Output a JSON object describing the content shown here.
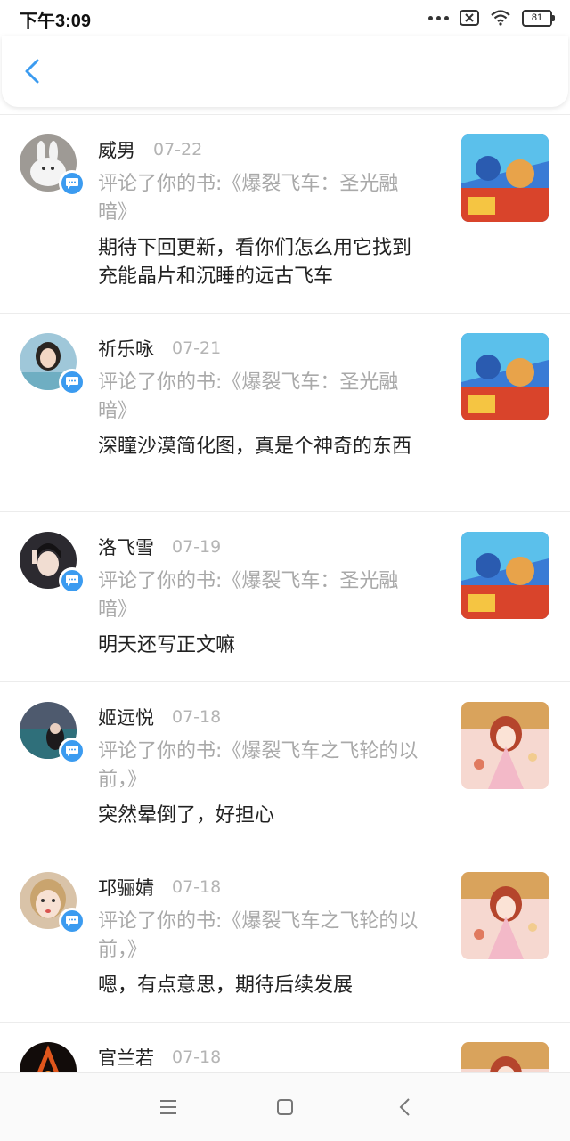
{
  "status_bar": {
    "time": "下午3:09",
    "battery": "81"
  },
  "colors": {
    "accent": "#3b9bf0",
    "meta_text": "#a9a9a9",
    "divider": "#ececec"
  },
  "icons": {
    "back": "chevron-left-icon",
    "badge": "comment-bubble-icon",
    "nav": [
      "menu-icon",
      "home-square-icon",
      "back-triangle-icon"
    ]
  },
  "notifications": [
    {
      "name": "威男",
      "date": "07-22",
      "summary": "评论了你的书:《爆裂飞车：圣光融暗》",
      "comment": "期待下回更新，看你们怎么用它找到充能晶片和沉睡的远古飞车"
    },
    {
      "name": "祈乐咏",
      "date": "07-21",
      "summary": "评论了你的书:《爆裂飞车：圣光融暗》",
      "comment": "深瞳沙漠简化图，真是个神奇的东西"
    },
    {
      "name": "洛飞雪",
      "date": "07-19",
      "summary": "评论了你的书:《爆裂飞车：圣光融暗》",
      "comment": "明天还写正文嘛"
    },
    {
      "name": "姬远悦",
      "date": "07-18",
      "summary": "评论了你的书:《爆裂飞车之飞轮的以前，》",
      "comment": "突然晕倒了，好担心"
    },
    {
      "name": "邛骊婧",
      "date": "07-18",
      "summary": "评论了你的书:《爆裂飞车之飞轮的以前，》",
      "comment": "嗯，有点意思，期待后续发展"
    },
    {
      "name": "官兰若",
      "date": "07-18",
      "summary": "",
      "comment": ""
    }
  ]
}
